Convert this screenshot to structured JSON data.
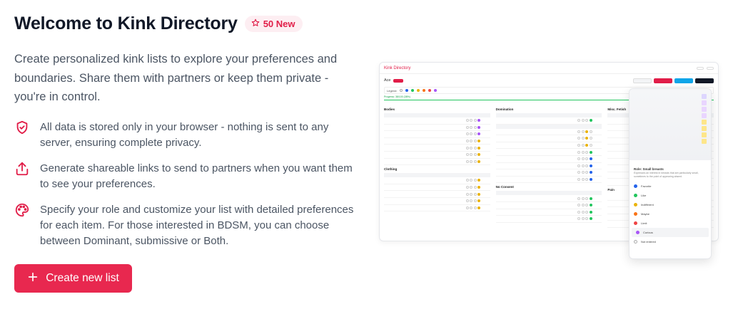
{
  "header": {
    "title": "Welcome to Kink Directory",
    "badge_label": "50 New"
  },
  "intro": "Create personalized kink lists to explore your preferences and boundaries. Share them with partners or keep them private - you're in control.",
  "features": [
    {
      "icon": "shield-check-icon",
      "text": "All data is stored only in your browser - nothing is sent to any server, ensuring complete privacy."
    },
    {
      "icon": "share-upload-icon",
      "text": "Generate shareable links to send to partners when you want them to see your preferences."
    },
    {
      "icon": "palette-icon",
      "text": "Specify your role and customize your list with detailed preferences for each item. For those interested in BDSM, you can choose between Dominant, submissive or Both."
    }
  ],
  "cta": {
    "label": "Create new list",
    "icon": "plus-icon"
  },
  "colors": {
    "accent": "#e8284f",
    "badge_bg": "#fdeef2",
    "text_muted": "#4b5563"
  },
  "preview": {
    "app_name": "Kink Directory",
    "list_name": "Ace",
    "legend_label": "Legend:",
    "progress_label": "Progress: 38/100 (38%)",
    "categories": [
      "Bodies",
      "Domination",
      "Misc. Fetish",
      "Clothing",
      "No Consent",
      "Pain"
    ],
    "popup": {
      "title": "Role: Small breasts",
      "description": "Expresses an interest in breasts that are particularly small, sometimes to the point of appearing absent.",
      "options": [
        "Favorite",
        "Like",
        "Indifferent",
        "Maybe",
        "Limit",
        "Curious",
        "Not entered"
      ]
    }
  }
}
